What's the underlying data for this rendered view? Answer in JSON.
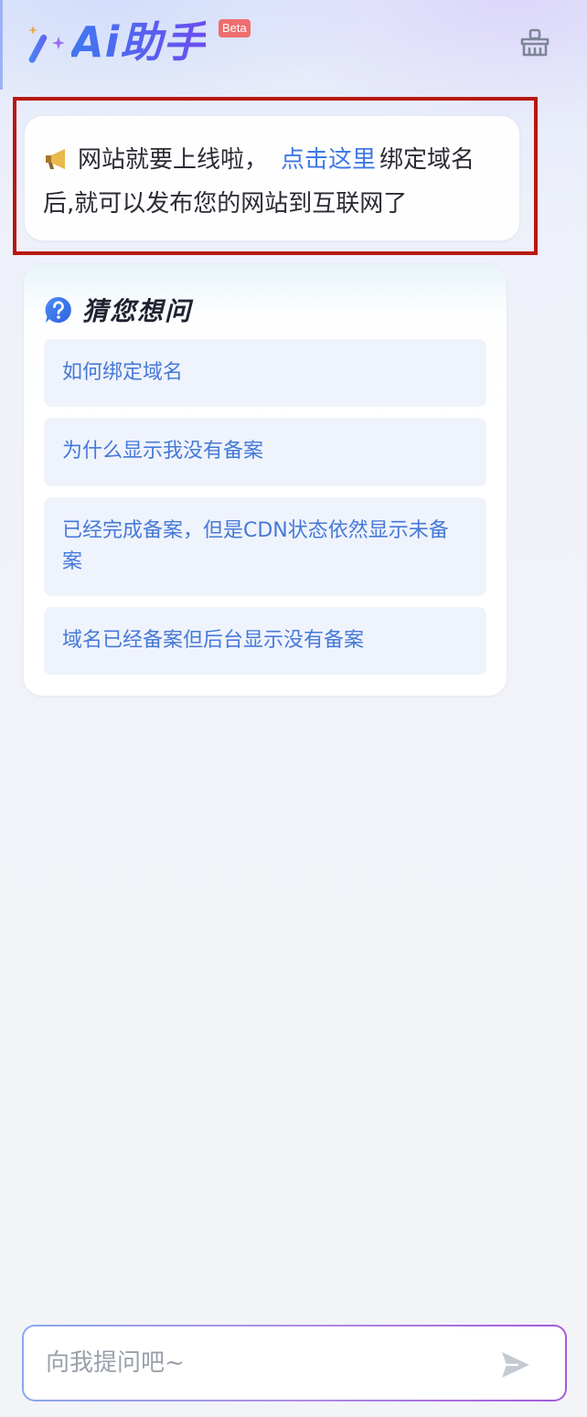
{
  "header": {
    "logo_text": "Ai助手",
    "beta_label": "Beta"
  },
  "notice": {
    "text_before": "网站就要上线啦，",
    "link_text": "点击这里",
    "text_after": "绑定域名后,就可以发布您的网站到互联网了"
  },
  "suggestions": {
    "title": "猜您想问",
    "items": [
      {
        "label": "如何绑定域名"
      },
      {
        "label": "为什么显示我没有备案"
      },
      {
        "label": "已经完成备案，但是CDN状态依然显示未备案"
      },
      {
        "label": "域名已经备案但后台显示没有备案"
      }
    ]
  },
  "input": {
    "placeholder": "向我提问吧~",
    "value": ""
  },
  "colors": {
    "accent": "#3e78e6",
    "highlight_border": "#b8180f",
    "suggestion_bg": "#eff3fc",
    "beta_badge": "#ee6e6e"
  },
  "icons": {
    "logo": "magic-wand-icon",
    "clear": "broom-icon",
    "notice": "megaphone-icon",
    "suggest": "question-bubble-icon",
    "send": "send-icon"
  }
}
